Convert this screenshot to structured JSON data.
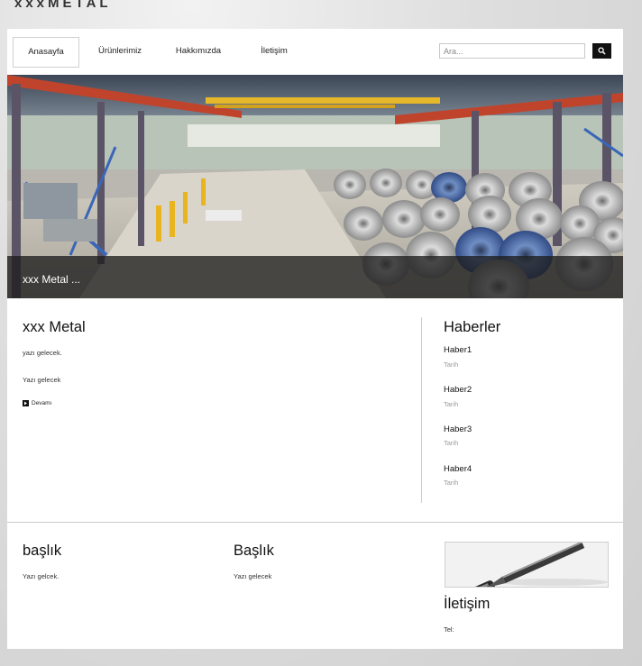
{
  "header": {
    "logo": "xxxMETAL"
  },
  "nav": {
    "items": [
      {
        "label": "Anasayfa"
      },
      {
        "label": "Ürünlerimiz"
      },
      {
        "label": "Hakkımızda"
      },
      {
        "label": "İletişim"
      }
    ]
  },
  "search": {
    "placeholder": "Ara..."
  },
  "hero": {
    "caption": "xxx Metal ..."
  },
  "intro": {
    "title": "xxx Metal",
    "text1": "yazı gelecek.",
    "text2": "Yazı gelecek",
    "more_label": "Devamı"
  },
  "news": {
    "title": "Haberler",
    "items": [
      {
        "title": "Haber1",
        "date": "Tarih"
      },
      {
        "title": "Haber2",
        "date": "Tarih"
      },
      {
        "title": "Haber3",
        "date": "Tarih"
      },
      {
        "title": "Haber4",
        "date": "Tarih"
      }
    ]
  },
  "footer": {
    "col1": {
      "title": "başlık",
      "text": "Yazı gelcek."
    },
    "col2": {
      "title": "Başlık",
      "text": "Yazı gelecek"
    },
    "contact": {
      "title": "İletişim",
      "tel_label": "Tel:"
    }
  }
}
